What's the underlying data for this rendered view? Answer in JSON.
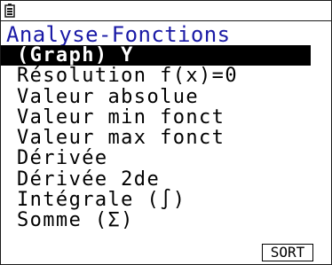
{
  "status_bar": {
    "battery_icon": "battery-icon"
  },
  "menu": {
    "title": "Analyse-Fonctions",
    "items": [
      {
        "label": "(Graph) Y",
        "selected": true
      },
      {
        "label": "Résolution f(x)=0",
        "selected": false
      },
      {
        "label": "Valeur absolue",
        "selected": false
      },
      {
        "label": "Valeur min fonct",
        "selected": false
      },
      {
        "label": "Valeur max fonct",
        "selected": false
      },
      {
        "label": "Dérivée",
        "selected": false
      },
      {
        "label": "Dérivée 2de",
        "selected": false
      },
      {
        "label": "Intégrale (∫)",
        "selected": false
      },
      {
        "label": "Somme (Σ)",
        "selected": false
      }
    ]
  },
  "softkeys": {
    "sort_label": "SORT"
  },
  "colors": {
    "title": "#1a1aa6",
    "selection_bg": "#000000",
    "selection_text": "#ffffff"
  }
}
